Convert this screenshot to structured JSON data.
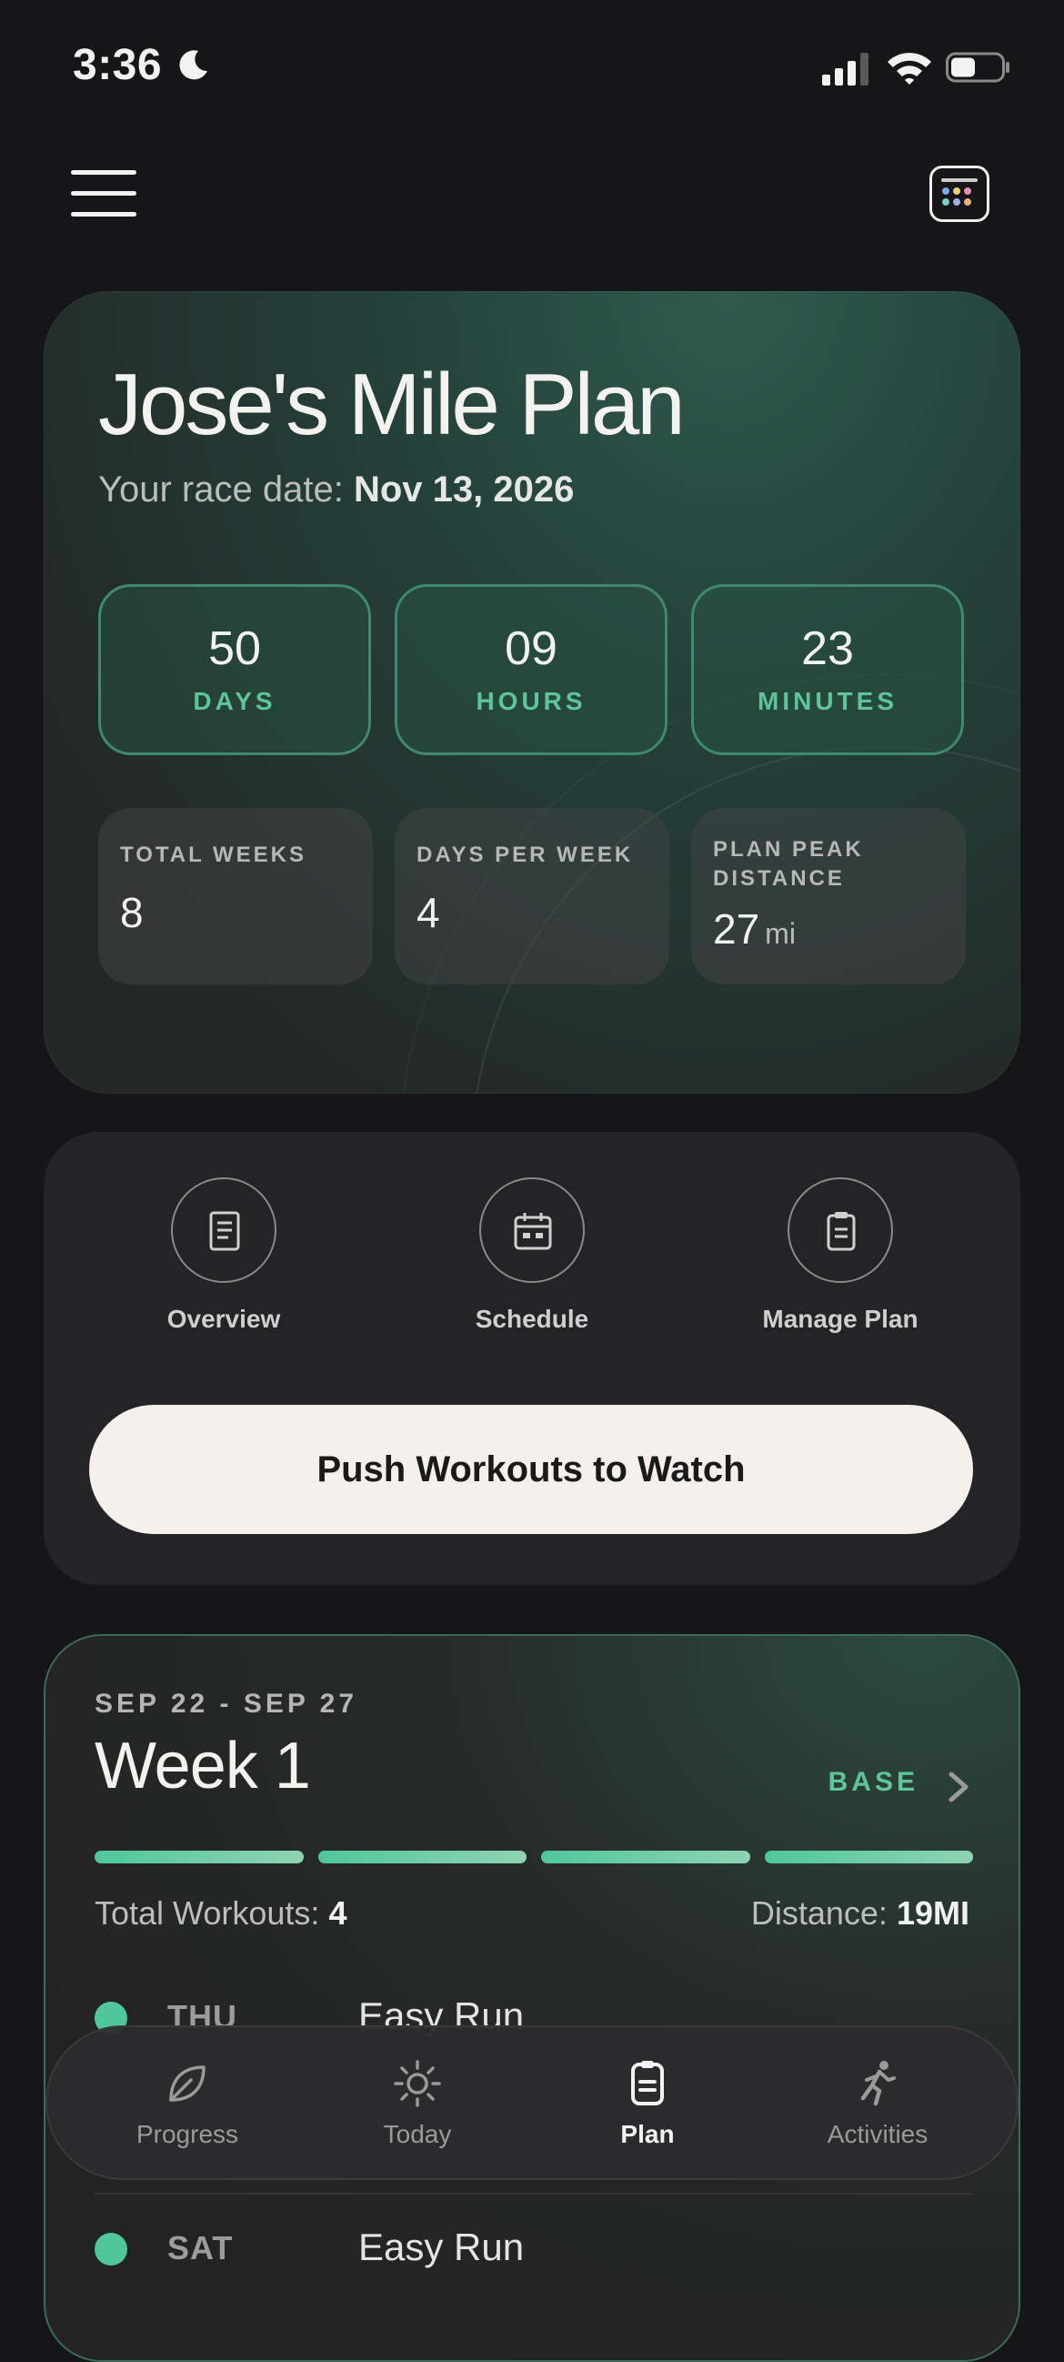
{
  "status": {
    "time": "3:36"
  },
  "plan": {
    "title": "Jose's Mile Plan",
    "race_label": "Your race date:",
    "race_date": "Nov 13, 2026",
    "countdown": [
      {
        "value": "50",
        "unit": "DAYS"
      },
      {
        "value": "09",
        "unit": "HOURS"
      },
      {
        "value": "23",
        "unit": "MINUTES"
      }
    ],
    "stats": [
      {
        "label": "TOTAL WEEKS",
        "value": "8",
        "unit": ""
      },
      {
        "label": "DAYS PER WEEK",
        "value": "4",
        "unit": ""
      },
      {
        "label": "PLAN PEAK DISTANCE",
        "value": "27",
        "unit": "mi"
      }
    ]
  },
  "actions": {
    "overview": "Overview",
    "schedule": "Schedule",
    "manage": "Manage Plan",
    "push": "Push Workouts to Watch"
  },
  "week": {
    "date_range": "SEP 22 - SEP 27",
    "title": "Week 1",
    "phase": "BASE",
    "progress_segments_filled": 4,
    "total_workouts_label": "Total Workouts:",
    "total_workouts": "4",
    "distance_label": "Distance:",
    "distance": "19MI",
    "workouts": [
      {
        "day": "THU",
        "name": "Easy Run"
      },
      {
        "day": "SAT",
        "name": "Easy Run"
      }
    ]
  },
  "tabs": [
    {
      "label": "Progress",
      "icon": "leaf-icon"
    },
    {
      "label": "Today",
      "icon": "sun-icon"
    },
    {
      "label": "Plan",
      "icon": "clipboard-icon",
      "active": true
    },
    {
      "label": "Activities",
      "icon": "runner-icon"
    }
  ],
  "colors": {
    "accent": "#5ec49a",
    "background": "#161618"
  }
}
